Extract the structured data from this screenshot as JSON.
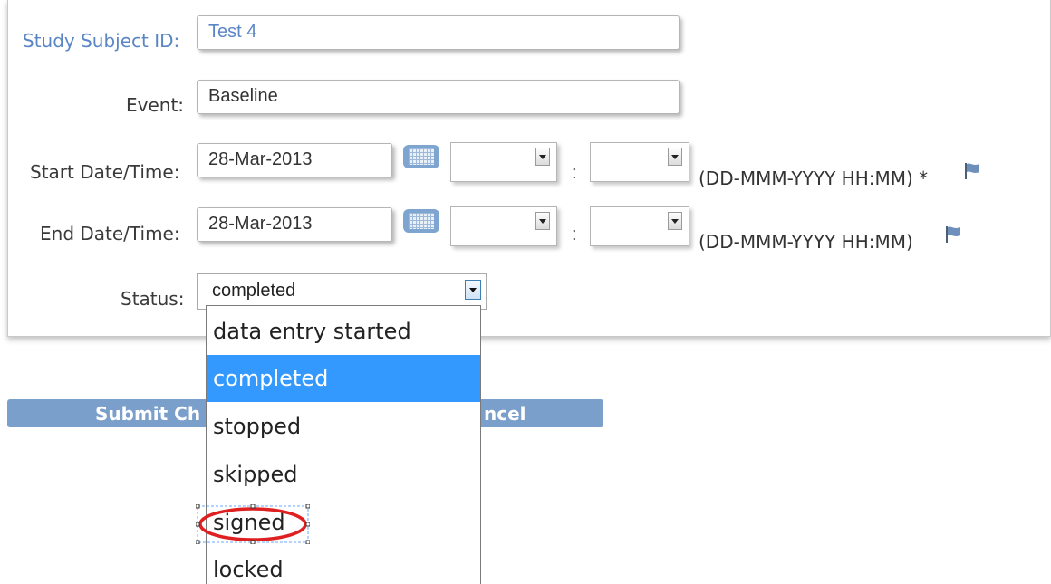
{
  "form": {
    "subject": {
      "label": "Study Subject ID:",
      "value": "Test 4"
    },
    "event": {
      "label": "Event:",
      "value": "Baseline"
    },
    "start": {
      "label": "Start Date/Time:",
      "date": "28-Mar-2013",
      "colon": ":",
      "hint": "(DD-MMM-YYYY HH:MM) *"
    },
    "end": {
      "label": "End Date/Time:",
      "date": "28-Mar-2013",
      "colon": ":",
      "hint": "(DD-MMM-YYYY HH:MM)"
    },
    "status": {
      "label": "Status:",
      "value": "completed"
    }
  },
  "buttons": {
    "submit": "Submit Ch",
    "cancel": "ncel"
  },
  "dropdown": {
    "options": [
      "data entry started",
      "completed",
      "stopped",
      "skipped",
      "signed",
      "locked"
    ],
    "selected": "completed"
  },
  "colors": {
    "accent": "#3399ff",
    "button_bar": "#7b9fcb",
    "label_blue": "#5b86c5",
    "annotation": "#e02020"
  },
  "icons": [
    "calendar-icon",
    "flag-icon",
    "chevron-down-icon"
  ]
}
